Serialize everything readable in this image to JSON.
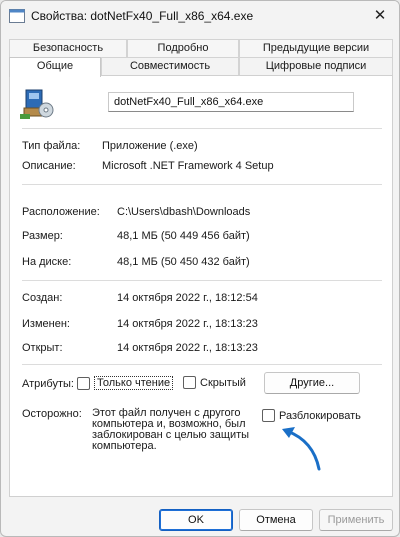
{
  "window": {
    "title": "Свойства: dotNetFx40_Full_x86_x64.exe",
    "close_glyph": "✕"
  },
  "tabs_back": [
    {
      "label": "Безопасность"
    },
    {
      "label": "Подробно"
    },
    {
      "label": "Предыдущие версии"
    }
  ],
  "tabs_front": [
    {
      "label": "Общие",
      "active": true
    },
    {
      "label": "Совместимость"
    },
    {
      "label": "Цифровые подписи"
    }
  ],
  "general": {
    "file_name": "dotNetFx40_Full_x86_x64.exe",
    "file_type_label": "Тип файла:",
    "file_type_value": "Приложение (.exe)",
    "description_label": "Описание:",
    "description_value": "Microsoft .NET Framework 4 Setup",
    "location_label": "Расположение:",
    "location_value": "C:\\Users\\dbash\\Downloads",
    "size_label": "Размер:",
    "size_value": "48,1 МБ (50 449 456 байт)",
    "on_disk_label": "На диске:",
    "on_disk_value": "48,1 МБ (50 450 432 байт)",
    "created_label": "Создан:",
    "created_value": "14 октября 2022 г., 18:12:54",
    "modified_label": "Изменен:",
    "modified_value": "14 октября 2022 г., 18:13:23",
    "opened_label": "Открыт:",
    "opened_value": "14 октября 2022 г., 18:13:23",
    "attributes_label": "Атрибуты:",
    "readonly_label": "Только чтение",
    "hidden_label": "Скрытый",
    "other_button": "Другие...",
    "warning_label": "Осторожно:",
    "warning_text": "Этот файл получен с другого компьютера и, возможно, был заблокирован с целью защиты компьютера.",
    "unblock_label": "Разблокировать"
  },
  "footer": {
    "ok": "OK",
    "cancel": "Отмена",
    "apply": "Применить"
  },
  "colors": {
    "accent": "#1e6fd6",
    "arrow": "#1a6fc7"
  }
}
